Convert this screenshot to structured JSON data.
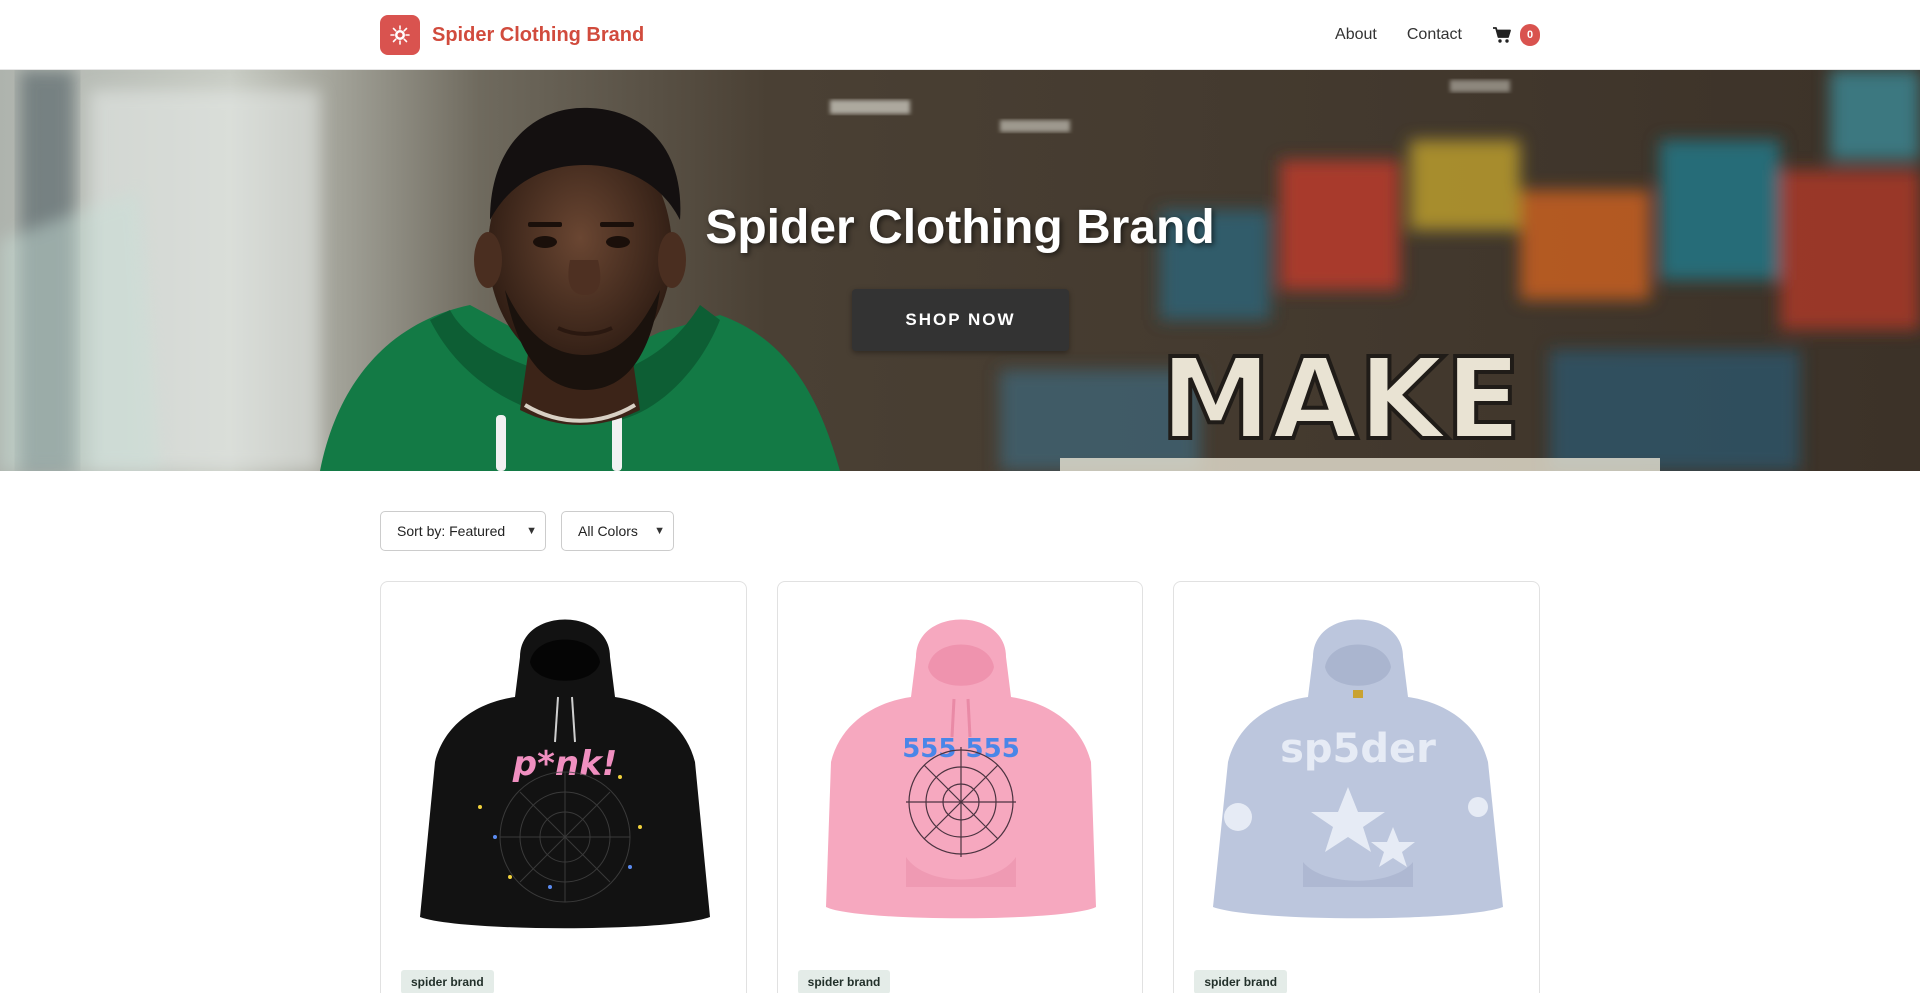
{
  "header": {
    "brand_name": "Spider Clothing Brand",
    "logo_icon": "spider-icon",
    "nav": [
      {
        "label": "About"
      },
      {
        "label": "Contact"
      }
    ],
    "cart": {
      "icon": "cart-icon",
      "count": "0"
    }
  },
  "hero": {
    "title": "Spider Clothing Brand",
    "cta_label": "SHOP NOW",
    "background_text": "MAKE"
  },
  "filters": {
    "sort_selected": "Sort by: Featured",
    "color_selected": "All Colors"
  },
  "products": [
    {
      "tag": "spider brand",
      "color": "#111111",
      "print_color": "#f08fc0",
      "print_text": "p*nk!"
    },
    {
      "tag": "spider brand",
      "color": "#f6a8bf",
      "print_color": "#4a86e8",
      "print_text": "555 555"
    },
    {
      "tag": "spider brand",
      "color": "#bcc6dd",
      "print_color": "#e6ebf5",
      "print_text": "sp5der"
    }
  ],
  "colors": {
    "accent": "#d9534f",
    "brand_text": "#d14b3d",
    "button_dark": "#333333"
  }
}
